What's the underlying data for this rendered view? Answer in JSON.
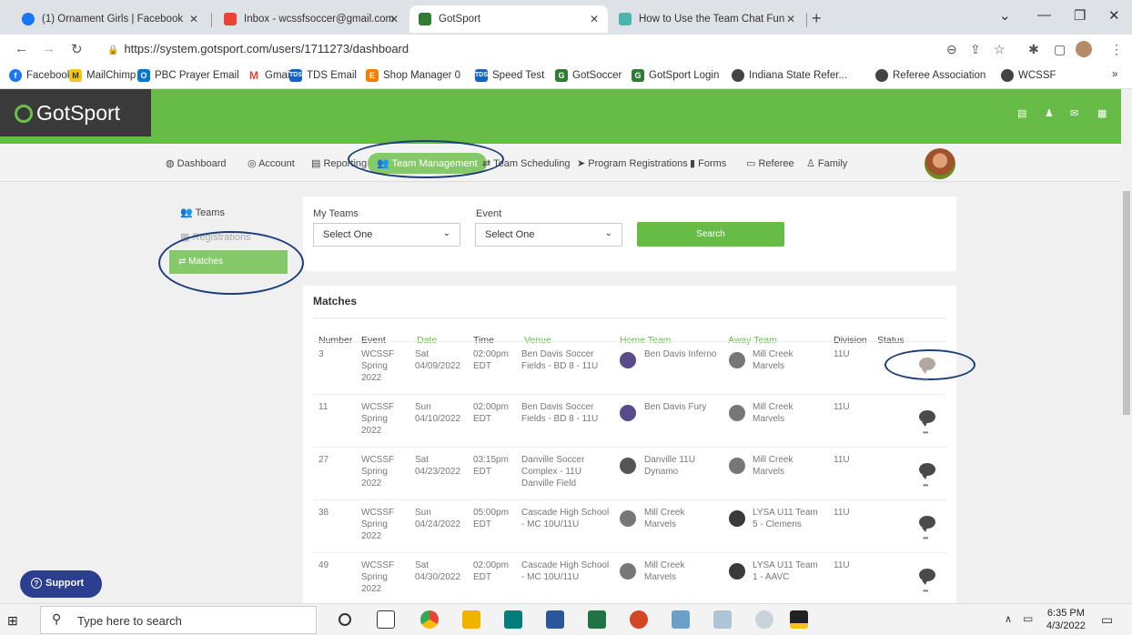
{
  "browser": {
    "tabs": [
      {
        "label": "(1) Ornament Girls | Facebook",
        "color": "#1877f2"
      },
      {
        "label": "Inbox - wcssfsoccer@gmail.com",
        "color": "#ea4335"
      },
      {
        "label": "GotSport",
        "color": "#2e7d32"
      },
      {
        "label": "How to Use the Team Chat Functi",
        "color": "#4db6ac"
      }
    ],
    "url": "https://system.gotsport.com/users/1711273/dashboard",
    "bookmarks": [
      {
        "label": "Facebook",
        "color": "#1877f2",
        "glyph": "f"
      },
      {
        "label": "MailChimp",
        "color": "#f5c518",
        "glyph": "M"
      },
      {
        "label": "PBC Prayer Email",
        "color": "#0078d4",
        "glyph": "O"
      },
      {
        "label": "Gmail",
        "color": "#ea4335",
        "glyph": "M"
      },
      {
        "label": "TDS Email",
        "color": "#1565c0",
        "glyph": "T"
      },
      {
        "label": "Shop Manager 0",
        "color": "#f57c00",
        "glyph": "E"
      },
      {
        "label": "Speed Test",
        "color": "#1565c0",
        "glyph": "T"
      },
      {
        "label": "GotSoccer",
        "color": "#2e7d32",
        "glyph": "G"
      },
      {
        "label": "GotSport Login",
        "color": "#2e7d32",
        "glyph": "G"
      },
      {
        "label": "Indiana State Refer...",
        "color": "#444",
        "glyph": "●"
      },
      {
        "label": "Referee Association",
        "color": "#444",
        "glyph": "●"
      },
      {
        "label": "WCSSF",
        "color": "#444",
        "glyph": "●"
      }
    ]
  },
  "site": {
    "logo": "GotSport",
    "nav": [
      {
        "label": "Dashboard",
        "icon": "dashboard-icon"
      },
      {
        "label": "Account",
        "icon": "account-icon"
      },
      {
        "label": "Reporting",
        "icon": "reporting-icon"
      },
      {
        "label": "Team Management",
        "icon": "team-icon"
      },
      {
        "label": "Team Scheduling",
        "icon": "scheduling-icon"
      },
      {
        "label": "Program Registrations",
        "icon": "send-icon"
      },
      {
        "label": "Forms",
        "icon": "forms-icon"
      },
      {
        "label": "Referee",
        "icon": "calendar-icon"
      },
      {
        "label": "Family",
        "icon": "family-icon"
      }
    ],
    "sidebar": {
      "teams": "Teams",
      "registrations": "Registrations",
      "matches": "Matches"
    }
  },
  "filters": {
    "my_teams_label": "My Teams",
    "my_teams_value": "Select One",
    "event_label": "Event",
    "event_value": "Select One",
    "search": "Search"
  },
  "matches": {
    "title": "Matches",
    "columns": [
      "Number",
      "Event",
      "Date",
      "Time",
      "Venue",
      "Home Team",
      "Away Team",
      "Division",
      "Status"
    ],
    "rows": [
      {
        "number": "3",
        "event": [
          "WCSSF",
          "Spring",
          "2022"
        ],
        "date": [
          "Sat",
          "04/09/2022"
        ],
        "time": [
          "02:00pm",
          "EDT"
        ],
        "venue": [
          "Ben Davis Soccer",
          "Fields - BD 8 - 11U"
        ],
        "home": [
          "Ben Davis Inferno"
        ],
        "away": [
          "Mill Creek",
          "Marvels"
        ],
        "division": "11U"
      },
      {
        "number": "11",
        "event": [
          "WCSSF",
          "Spring",
          "2022"
        ],
        "date": [
          "Sun",
          "04/10/2022"
        ],
        "time": [
          "02:00pm",
          "EDT"
        ],
        "venue": [
          "Ben Davis Soccer",
          "Fields - BD 8 - 11U"
        ],
        "home": [
          "Ben Davis Fury"
        ],
        "away": [
          "Mill Creek",
          "Marvels"
        ],
        "division": "11U"
      },
      {
        "number": "27",
        "event": [
          "WCSSF",
          "Spring",
          "2022"
        ],
        "date": [
          "Sat",
          "04/23/2022"
        ],
        "time": [
          "03:15pm",
          "EDT"
        ],
        "venue": [
          "Danville Soccer",
          "Complex - 11U",
          "Danville Field"
        ],
        "home": [
          "Danville 11U",
          "Dynamo"
        ],
        "away": [
          "Mill Creek",
          "Marvels"
        ],
        "division": "11U"
      },
      {
        "number": "38",
        "event": [
          "WCSSF",
          "Spring",
          "2022"
        ],
        "date": [
          "Sun",
          "04/24/2022"
        ],
        "time": [
          "05:00pm",
          "EDT"
        ],
        "venue": [
          "Cascade High School",
          "- MC 10U/11U"
        ],
        "home": [
          "Mill Creek",
          "Marvels"
        ],
        "away": [
          "LYSA U11 Team",
          "5 - Clemens"
        ],
        "division": "11U"
      },
      {
        "number": "49",
        "event": [
          "WCSSF",
          "Spring",
          "2022"
        ],
        "date": [
          "Sat",
          "04/30/2022"
        ],
        "time": [
          "02:00pm",
          "EDT"
        ],
        "venue": [
          "Cascade High School",
          "- MC 10U/11U"
        ],
        "home": [
          "Mill Creek",
          "Marvels"
        ],
        "away": [
          "LYSA U11 Team",
          "1 - AAVC"
        ],
        "division": "11U"
      }
    ]
  },
  "support": "Support",
  "taskbar": {
    "search_placeholder": "Type here to search",
    "time": "6:35 PM",
    "date": "4/3/2022"
  },
  "colors": {
    "brand_green": "#66bc46",
    "highlight_oval": "#1c3d7a"
  }
}
